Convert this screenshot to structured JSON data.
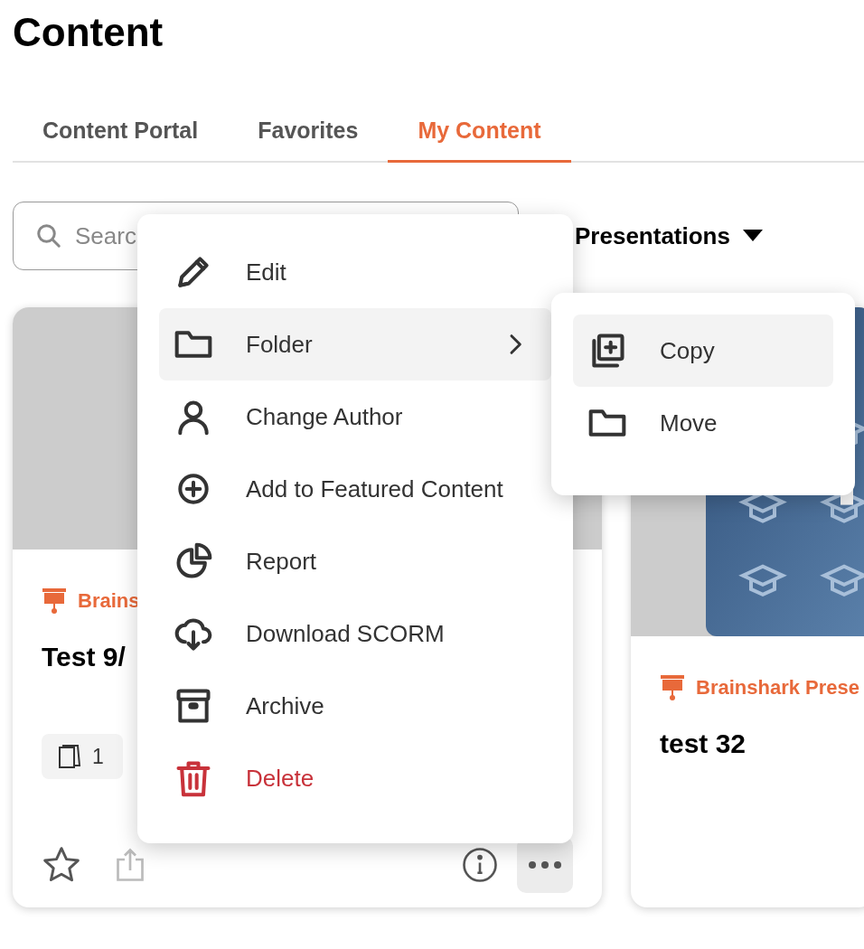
{
  "page": {
    "title": "Content"
  },
  "tabs": [
    {
      "label": "Content Portal",
      "selected": false
    },
    {
      "label": "Favorites",
      "selected": false
    },
    {
      "label": "My Content",
      "selected": true
    }
  ],
  "search": {
    "placeholder": "Searc"
  },
  "filter": {
    "label": "Presentations"
  },
  "cards": [
    {
      "type_label": "Brains",
      "title": "Test 9/",
      "page_count": "1",
      "favorite": false
    },
    {
      "type_label": "Brainshark Prese",
      "title": "test 32"
    }
  ],
  "menu": [
    {
      "label": "Edit",
      "kind": "plain",
      "selected": false
    },
    {
      "label": "Folder",
      "kind": "submenu",
      "selected": true
    },
    {
      "label": "Change Author",
      "kind": "plain",
      "selected": false
    },
    {
      "label": "Add to Featured Content",
      "kind": "plain",
      "selected": false
    },
    {
      "label": "Report",
      "kind": "plain",
      "selected": false
    },
    {
      "label": "Download SCORM",
      "kind": "plain",
      "selected": false
    },
    {
      "label": "Archive",
      "kind": "plain",
      "selected": false
    },
    {
      "label": "Delete",
      "kind": "danger",
      "selected": false
    }
  ],
  "submenu": [
    {
      "label": "Copy",
      "selected": true
    },
    {
      "label": "Move",
      "selected": false
    }
  ]
}
